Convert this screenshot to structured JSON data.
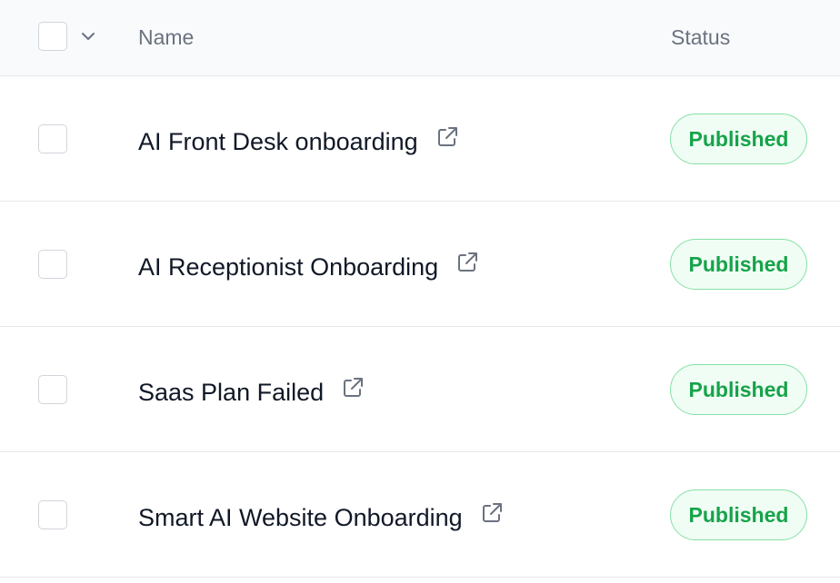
{
  "header": {
    "name_label": "Name",
    "status_label": "Status",
    "chevron_icon": "chevron-down-icon"
  },
  "rows": [
    {
      "name": "AI Front Desk onboarding",
      "status": "Published",
      "icon": "external-link-icon"
    },
    {
      "name": "AI Receptionist Onboarding",
      "status": "Published",
      "icon": "external-link-icon"
    },
    {
      "name": "Saas Plan Failed",
      "status": "Published",
      "icon": "external-link-icon"
    },
    {
      "name": "Smart AI Website Onboarding",
      "status": "Published",
      "icon": "external-link-icon"
    }
  ],
  "colors": {
    "status_published_text": "#16a34a",
    "status_published_border": "#86e0a5",
    "status_published_bg": "#f0fdf4",
    "header_bg": "#f9fafb",
    "divider": "#e5e7eb"
  }
}
